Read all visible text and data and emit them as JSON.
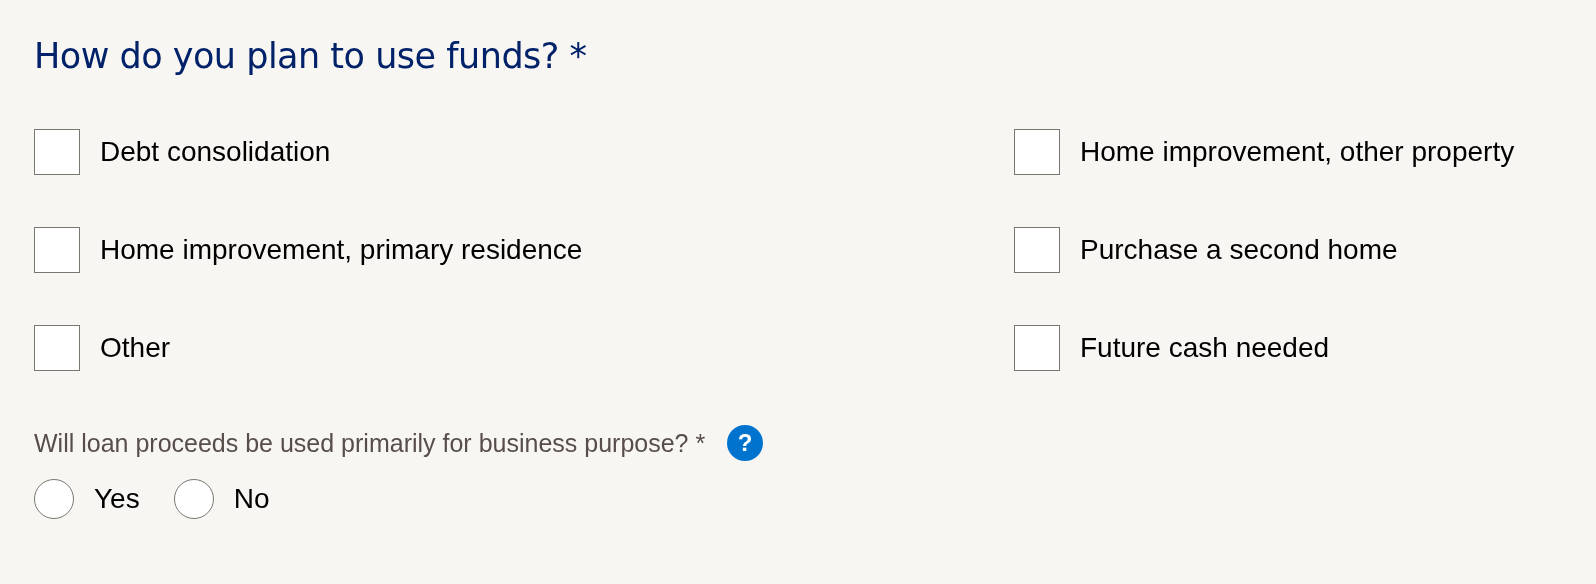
{
  "title": "How do you plan to use funds? *",
  "options": [
    {
      "label": "Debt consolidation",
      "checked": false
    },
    {
      "label": "Home improvement, other property",
      "checked": false
    },
    {
      "label": "Home improvement, primary residence",
      "checked": false
    },
    {
      "label": "Purchase a second home",
      "checked": false
    },
    {
      "label": "Other",
      "checked": false
    },
    {
      "label": "Future cash needed",
      "checked": false
    }
  ],
  "question": {
    "text": "Will loan proceeds be used primarily for business purpose? *",
    "help": "?"
  },
  "answers": [
    {
      "label": "Yes",
      "selected": false
    },
    {
      "label": "No",
      "selected": false
    }
  ]
}
